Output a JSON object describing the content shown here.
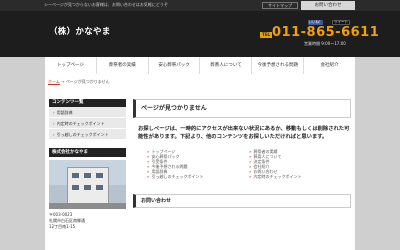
{
  "topbar": {
    "message": "シーページが見つからないお客様は、お問い合わせはお気軽にどうぞ",
    "sitemap_label": "サイトマップ",
    "contact_label": "お問い合わせ"
  },
  "header": {
    "logo": "（株）かなやま",
    "share": {
      "facebook": "いいね！",
      "twitter": "ツイート"
    },
    "tel_badge": "TEL",
    "tel": "011-865-6611",
    "hours": "営業時間 9:00〜17:00"
  },
  "nav": [
    "トップページ",
    "葬祭者の実績",
    "安心葬祭パック",
    "葬斎人について",
    "今後予想される問題",
    "会社紹介"
  ],
  "breadcrumb": {
    "home": "ホーム",
    "sep": "→",
    "current": "ページが見つかりません"
  },
  "sidebar": {
    "heading": "コンテンツ一覧",
    "items": [
      "用語辞典",
      "内定時のチェックポイント",
      "引っ越しのチェックポイント"
    ],
    "company_heading": "株式会社かなやま",
    "address": [
      "〒003-0023",
      "札幌市白石区南郷通",
      "12丁目南1-15"
    ]
  },
  "main": {
    "title": "ページが見つかりません",
    "message": "お探しページは、一時的にアクセスが出来ない状況にあるか、移動もしくは削除された可能性があります。下記より、他のコンテンツをお探しいただければと思います。",
    "links_left": [
      "トップページ",
      "安心葬祭パック",
      "引受条件",
      "今後予想される問題",
      "用語辞典",
      "引っ越しのチェックポイント"
    ],
    "links_right": [
      "葬祭者の実績",
      "葬斎人について",
      "決定条件",
      "会社紹介",
      "お問い合わせ",
      "内定時のチェックポイント"
    ],
    "contact_heading": "お問い合わせ"
  },
  "colors": {
    "accent": "#f2a200",
    "dark": "#1d1d1d",
    "link_arrow": "#c0392b"
  }
}
